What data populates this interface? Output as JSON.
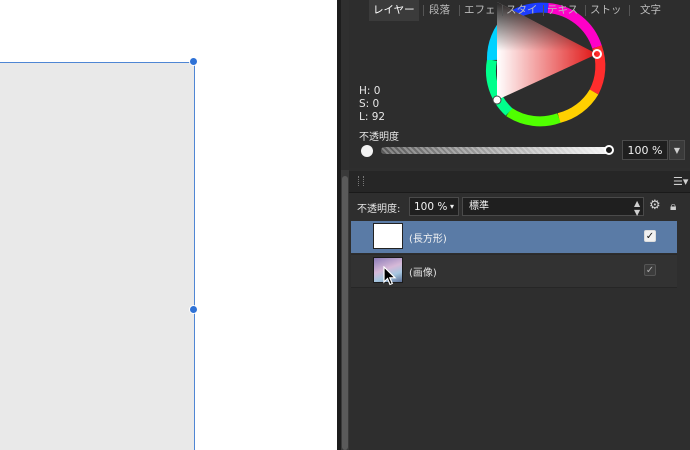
{
  "color_panel": {
    "h": "H: 0",
    "s": "S: 0",
    "l": "L: 92",
    "opacity_label": "不透明度",
    "opacity_value": "100 %",
    "opacity_level": 1.0
  },
  "tabs": [
    {
      "label": "レイヤー",
      "active": true
    },
    {
      "label": "段落",
      "active": false
    },
    {
      "label": "エフェ",
      "active": false
    },
    {
      "label": "スタイ",
      "active": false
    },
    {
      "label": "テキス",
      "active": false
    },
    {
      "label": "ストッ",
      "active": false
    },
    {
      "label": "文字",
      "active": false
    }
  ],
  "layer_toolbar": {
    "opacity_label": "不透明度:",
    "opacity_value": "100 %",
    "blend_mode": "標準"
  },
  "layers": [
    {
      "name": "(長方形)",
      "selected": true,
      "visible": true
    },
    {
      "name": "(画像)",
      "selected": false,
      "visible": true
    }
  ],
  "icons": {
    "gear": "gear-icon",
    "lock": "lock-icon",
    "panel_menu": "panel-menu-icon",
    "cursor": "mouse-pointer-icon"
  },
  "colors": {
    "accent_selection": "#5a7ba6",
    "handle_blue": "#2f72d6",
    "panel_bg": "#2e2e2e"
  }
}
